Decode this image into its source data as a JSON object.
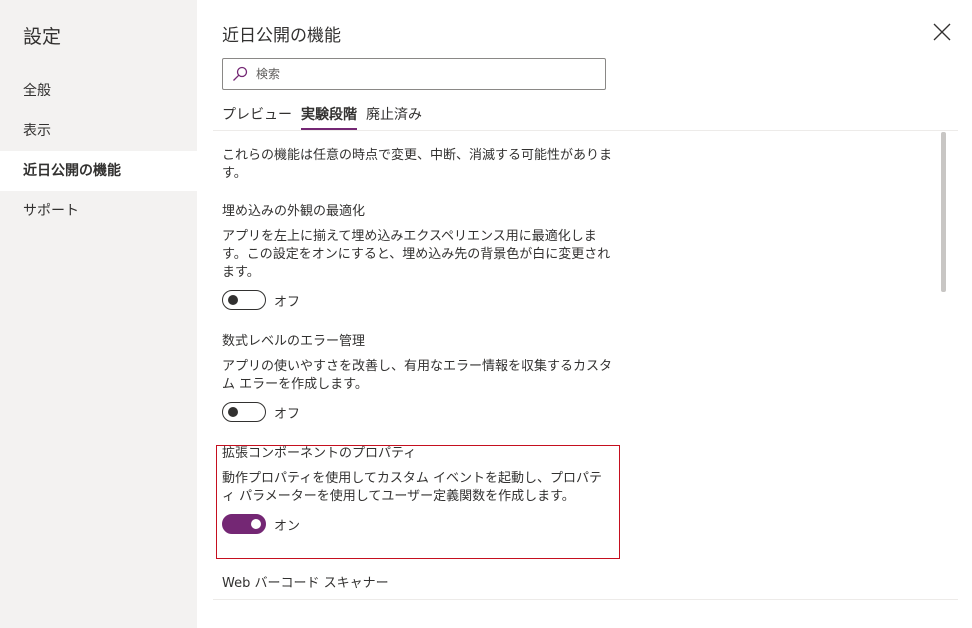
{
  "sidebar": {
    "title": "設定",
    "items": [
      {
        "label": "全般",
        "active": false
      },
      {
        "label": "表示",
        "active": false
      },
      {
        "label": "近日公開の機能",
        "active": true
      },
      {
        "label": "サポート",
        "active": false
      }
    ]
  },
  "main": {
    "title": "近日公開の機能",
    "close_icon": "close-icon",
    "search": {
      "placeholder": "検索",
      "value": "",
      "icon": "search-icon"
    },
    "tabs": [
      {
        "label": "プレビュー",
        "active": false
      },
      {
        "label": "実験段階",
        "active": true
      },
      {
        "label": "廃止済み",
        "active": false
      }
    ],
    "intro": "これらの機能は任意の時点で変更、中断、消滅する可能性があります。",
    "features": [
      {
        "title": "埋め込みの外観の最適化",
        "description": "アプリを左上に揃えて埋め込みエクスペリエンス用に最適化します。この設定をオンにすると、埋め込み先の背景色が白に変更されます。",
        "toggle_on": false,
        "toggle_label": "オフ"
      },
      {
        "title": "数式レベルのエラー管理",
        "description": "アプリの使いやすさを改善し、有用なエラー情報を収集するカスタム エラーを作成します。",
        "toggle_on": false,
        "toggle_label": "オフ"
      },
      {
        "title": "拡張コンポーネントのプロパティ",
        "description": "動作プロパティを使用してカスタム イベントを起動し、プロパティ パラメーターを使用してユーザー定義関数を作成します。",
        "toggle_on": true,
        "toggle_label": "オン"
      },
      {
        "title": "Web バーコード スキャナー"
      }
    ]
  },
  "colors": {
    "accent": "#742774",
    "highlight_border": "#c50f1f",
    "sidebar_bg": "#f3f2f1"
  }
}
